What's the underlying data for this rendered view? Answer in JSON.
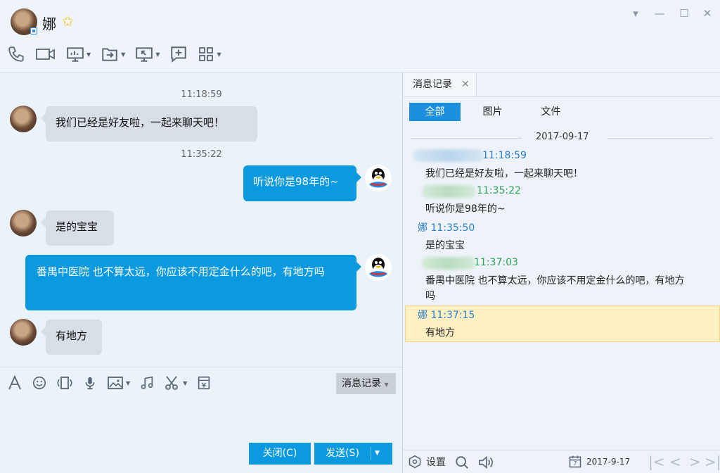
{
  "header": {
    "contact_name": "娜",
    "window_controls": [
      "chevron-down-icon",
      "minimize-icon",
      "maximize-icon",
      "close-icon"
    ],
    "toolbar_icons": [
      "phone-icon",
      "video-icon",
      "screen-share-icon",
      "file-transfer-icon",
      "remote-assist-icon",
      "group-chat-icon",
      "apps-grid-icon"
    ]
  },
  "chat": {
    "messages": [
      {
        "type": "time",
        "text": "11:18:59"
      },
      {
        "type": "in",
        "text": "我们已经是好友啦，一起来聊天吧！"
      },
      {
        "type": "time",
        "text": "11:35:22"
      },
      {
        "type": "out",
        "text": "听说你是98年的~"
      },
      {
        "type": "in",
        "text": "是的宝宝"
      },
      {
        "type": "out",
        "text": "番禺中医院 也不算太远，你应该不用定金什么的吧，有地方吗"
      },
      {
        "type": "in",
        "text": "有地方"
      }
    ]
  },
  "input": {
    "tools": [
      "font-icon",
      "emoji-icon",
      "shake-icon",
      "mic-icon",
      "image-icon",
      "music-icon",
      "scissors-icon",
      "red-packet-icon"
    ],
    "history_button": "消息记录",
    "close_button": "关闭(C)",
    "send_button": "发送(S)"
  },
  "history": {
    "tab_label": "消息记录",
    "filters": [
      "全部",
      "图片",
      "文件"
    ],
    "active_filter": "全部",
    "date": "2017-09-17",
    "records": [
      {
        "sender": "",
        "time": "11:18:59",
        "text": "我们已经是好友啦，一起来聊天吧！",
        "color": "#2a7fc9"
      },
      {
        "sender": "",
        "time": "11:35:22",
        "text": "听说你是98年的~",
        "color": "#2fa25a"
      },
      {
        "sender": "娜",
        "time": "11:35:50",
        "text": "是的宝宝",
        "color": "#2a7fc9"
      },
      {
        "sender": "",
        "time": "11:37:03",
        "text": "番禺中医院 也不算太远，你应该不用定金什么的吧，有地方吗",
        "color": "#2fa25a"
      },
      {
        "sender": "娜",
        "time": "11:37:15",
        "text": "有地方",
        "color": "#2a7fc9"
      }
    ],
    "footer": {
      "settings_label": "设置",
      "date_label": "2017-9-17",
      "calendar_day": "7"
    }
  },
  "colors": {
    "accent": "#0b9ae0",
    "bubble_in": "#d7dee6",
    "highlight": "#fff0c4"
  }
}
